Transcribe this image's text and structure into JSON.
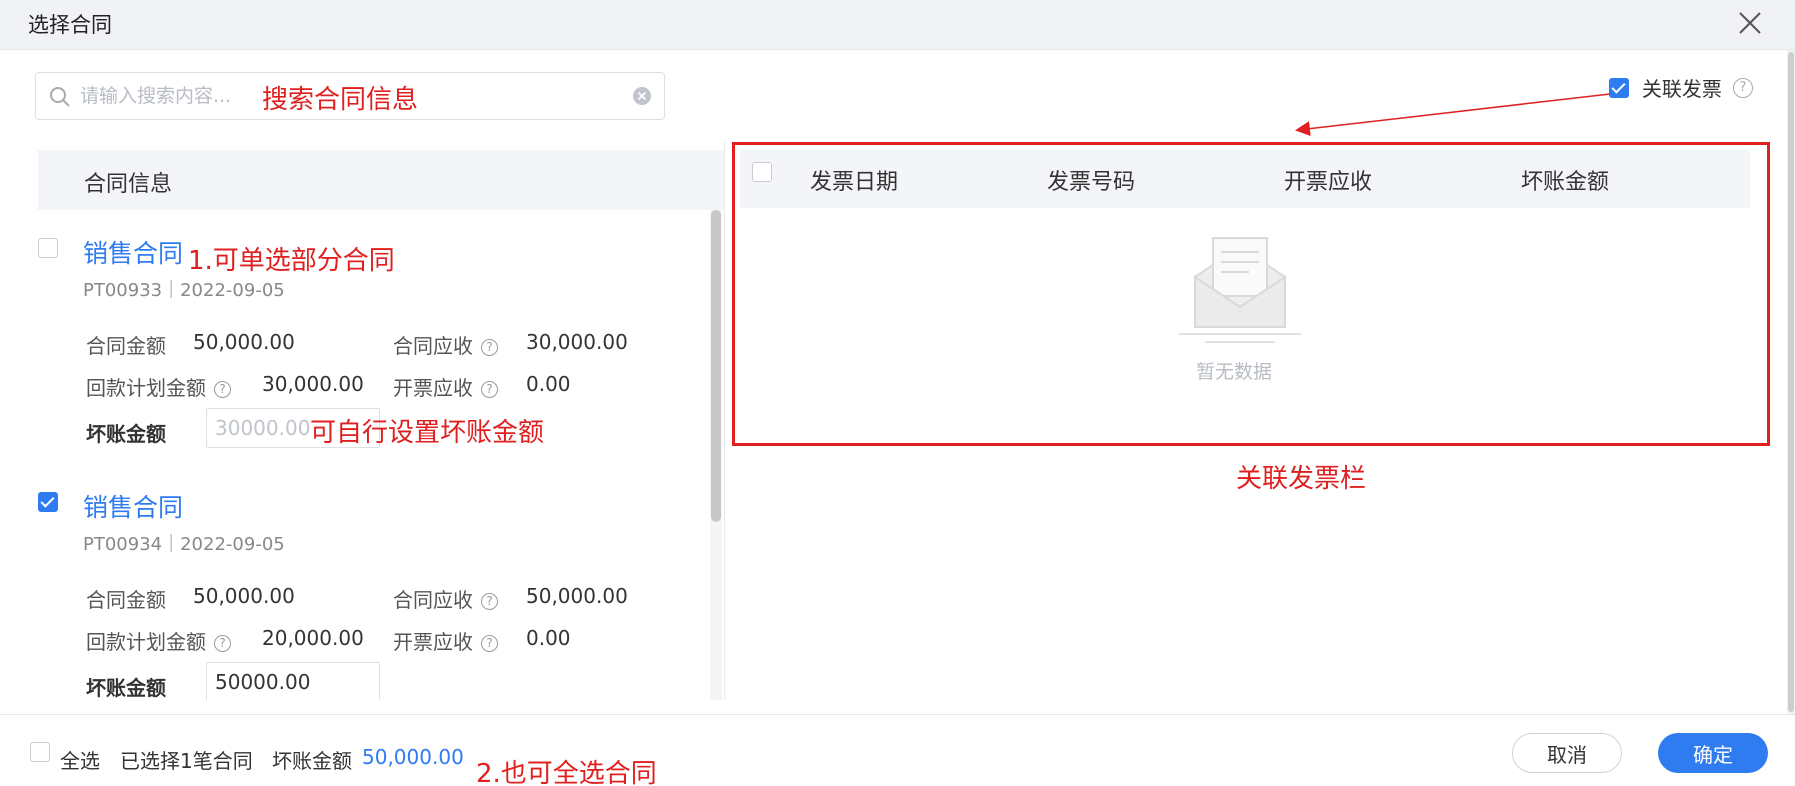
{
  "dialog": {
    "title": "选择合同",
    "close_icon": "close-icon"
  },
  "search": {
    "placeholder": "请输入搜索内容...",
    "value": "",
    "annotation": "搜索合同信息"
  },
  "left_panel": {
    "header": "合同信息",
    "contracts": [
      {
        "name": "销售合同",
        "annotation": "1.可单选部分合同",
        "meta": "PT00933｜2022-09-05",
        "checked": false,
        "amount_label": "合同金额",
        "amount_value": "50,000.00",
        "receivable_label": "合同应收",
        "receivable_value": "30,000.00",
        "plan_label": "回款计划金额",
        "plan_value": "30,000.00",
        "invoiced_label": "开票应收",
        "invoiced_value": "0.00",
        "bad_debt_label": "坏账金额",
        "bad_debt_value": "",
        "bad_debt_placeholder": "30000.00",
        "input_annotation": "可自行设置坏账金额"
      },
      {
        "name": "销售合同",
        "annotation": "",
        "meta": "PT00934｜2022-09-05",
        "checked": true,
        "amount_label": "合同金额",
        "amount_value": "50,000.00",
        "receivable_label": "合同应收",
        "receivable_value": "50,000.00",
        "plan_label": "回款计划金额",
        "plan_value": "20,000.00",
        "invoiced_label": "开票应收",
        "invoiced_value": "0.00",
        "bad_debt_label": "坏账金额",
        "bad_debt_value": "50000.00",
        "bad_debt_placeholder": "",
        "input_annotation": ""
      }
    ]
  },
  "right_panel": {
    "link_invoice_label": "关联发票",
    "link_invoice_checked": true,
    "columns": [
      "发票日期",
      "发票号码",
      "开票应收",
      "坏账金额"
    ],
    "empty_text": "暂无数据",
    "frame_annotation": "关联发票栏"
  },
  "footer": {
    "select_all_label": "全选",
    "selected_text": "已选择1笔合同",
    "bad_debt_label": "坏账金额",
    "bad_debt_total": "50,000.00",
    "annotation": "2.也可全选合同",
    "cancel_label": "取消",
    "ok_label": "确定"
  },
  "colors": {
    "accent": "#2f7bf0",
    "annotation": "#e02020"
  }
}
